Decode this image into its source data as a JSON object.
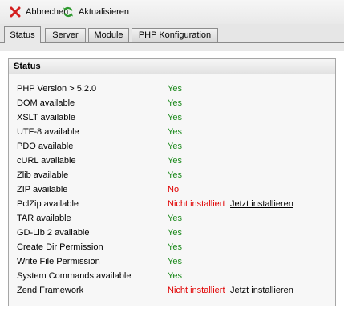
{
  "toolbar": {
    "cancel_label": "Abbrechen",
    "refresh_label": "Aktualisieren"
  },
  "tabs": [
    {
      "label": "Status",
      "active": true
    },
    {
      "label": "Server",
      "active": false
    },
    {
      "label": "Module",
      "active": false
    },
    {
      "label": "PHP Konfiguration",
      "active": false
    }
  ],
  "panel": {
    "title": "Status"
  },
  "checks": [
    {
      "label": "PHP Version > 5.2.0",
      "value": "Yes",
      "status": "ok"
    },
    {
      "label": "DOM available",
      "value": "Yes",
      "status": "ok"
    },
    {
      "label": "XSLT available",
      "value": "Yes",
      "status": "ok"
    },
    {
      "label": "UTF-8 available",
      "value": "Yes",
      "status": "ok"
    },
    {
      "label": "PDO available",
      "value": "Yes",
      "status": "ok"
    },
    {
      "label": "cURL available",
      "value": "Yes",
      "status": "ok"
    },
    {
      "label": "Zlib available",
      "value": "Yes",
      "status": "ok"
    },
    {
      "label": "ZIP available",
      "value": "No",
      "status": "bad"
    },
    {
      "label": "PclZip available",
      "value": "Nicht installiert",
      "status": "bad",
      "action": "Jetzt installieren"
    },
    {
      "label": "TAR available",
      "value": "Yes",
      "status": "ok"
    },
    {
      "label": "GD-Lib 2 available",
      "value": "Yes",
      "status": "ok"
    },
    {
      "label": "Create Dir Permission",
      "value": "Yes",
      "status": "ok"
    },
    {
      "label": "Write File Permission",
      "value": "Yes",
      "status": "ok"
    },
    {
      "label": "System Commands available",
      "value": "Yes",
      "status": "ok"
    },
    {
      "label": "Zend Framework",
      "value": "Nicht installiert",
      "status": "bad",
      "action": "Jetzt installieren"
    }
  ],
  "colors": {
    "ok": "#1d8a1d",
    "bad": "#e00000",
    "cancel_icon": "#d42020",
    "refresh_icon": "#2f9a2f"
  },
  "icons": {
    "cancel": "close-icon",
    "refresh": "refresh-icon"
  }
}
